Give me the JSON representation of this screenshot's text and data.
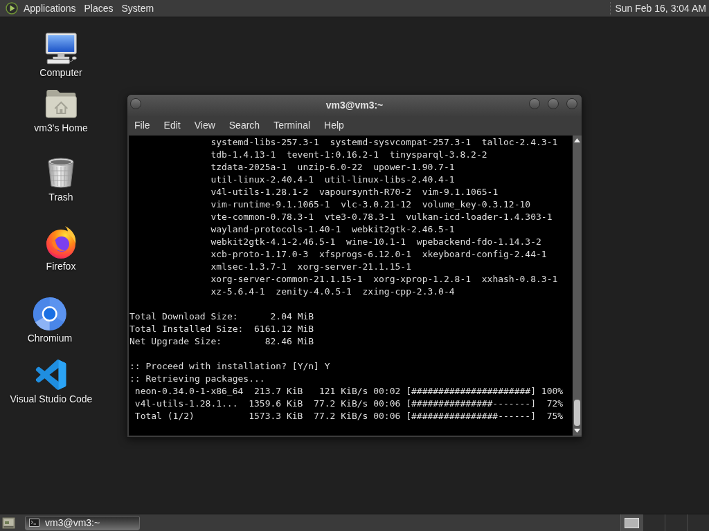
{
  "top_panel": {
    "menus": [
      "Applications",
      "Places",
      "System"
    ],
    "clock": "Sun Feb 16, 3:04 AM"
  },
  "desktop_icons": [
    {
      "kind": "computer",
      "label": "Computer"
    },
    {
      "kind": "home",
      "label": "vm3's Home"
    },
    {
      "kind": "trash",
      "label": "Trash"
    },
    {
      "kind": "firefox",
      "label": "Firefox"
    },
    {
      "kind": "chromium",
      "label": "Chromium"
    },
    {
      "kind": "vscode",
      "label": "Visual Studio Code"
    }
  ],
  "window": {
    "title": "vm3@vm3:~",
    "menu": [
      "File",
      "Edit",
      "View",
      "Search",
      "Terminal",
      "Help"
    ],
    "terminal_lines": [
      {
        "kind": "package",
        "text": "systemd-libs-257.3-1  systemd-sysvcompat-257.3-1  talloc-2.4.3-1"
      },
      {
        "kind": "package",
        "text": "tdb-1.4.13-1  tevent-1:0.16.2-1  tinysparql-3.8.2-2"
      },
      {
        "kind": "package",
        "text": "tzdata-2025a-1  unzip-6.0-22  upower-1.90.7-1"
      },
      {
        "kind": "package",
        "text": "util-linux-2.40.4-1  util-linux-libs-2.40.4-1"
      },
      {
        "kind": "package",
        "text": "v4l-utils-1.28.1-2  vapoursynth-R70-2  vim-9.1.1065-1"
      },
      {
        "kind": "package",
        "text": "vim-runtime-9.1.1065-1  vlc-3.0.21-12  volume_key-0.3.12-10"
      },
      {
        "kind": "package",
        "text": "vte-common-0.78.3-1  vte3-0.78.3-1  vulkan-icd-loader-1.4.303-1"
      },
      {
        "kind": "package",
        "text": "wayland-protocols-1.40-1  webkit2gtk-2.46.5-1"
      },
      {
        "kind": "package",
        "text": "webkit2gtk-4.1-2.46.5-1  wine-10.1-1  wpebackend-fdo-1.14.3-2"
      },
      {
        "kind": "package",
        "text": "xcb-proto-1.17.0-3  xfsprogs-6.12.0-1  xkeyboard-config-2.44-1"
      },
      {
        "kind": "package",
        "text": "xmlsec-1.3.7-1  xorg-server-21.1.15-1"
      },
      {
        "kind": "package",
        "text": "xorg-server-common-21.1.15-1  xorg-xprop-1.2.8-1  xxhash-0.8.3-1"
      },
      {
        "kind": "package",
        "text": "xz-5.6.4-1  zenity-4.0.5-1  zxing-cpp-2.3.0-4"
      },
      {
        "kind": "blank"
      },
      {
        "kind": "output",
        "text": "Total Download Size:      2.04 MiB"
      },
      {
        "kind": "output",
        "text": "Total Installed Size:  6161.12 MiB"
      },
      {
        "kind": "output",
        "text": "Net Upgrade Size:        82.46 MiB"
      },
      {
        "kind": "blank"
      },
      {
        "kind": "output",
        "text": ":: Proceed with installation? [Y/n] Y"
      },
      {
        "kind": "output",
        "text": ":: Retrieving packages..."
      },
      {
        "kind": "progress",
        "text": "neon-0.34.0-1-x86_64  213.7 KiB   121 KiB/s 00:02 [######################] 100%"
      },
      {
        "kind": "progress",
        "text": "v4l-utils-1.28.1...  1359.6 KiB  77.2 KiB/s 00:06 [###############-------]  72%"
      },
      {
        "kind": "progress",
        "text": "Total (1/2)          1573.3 KiB  77.2 KiB/s 00:06 [################------]  75%"
      }
    ]
  },
  "taskbar": {
    "tasks": [
      {
        "label": "vm3@vm3:~",
        "selected": true
      }
    ],
    "workspaces": [
      {
        "selected": true
      },
      {
        "selected": false
      },
      {
        "selected": false
      },
      {
        "selected": false
      }
    ]
  }
}
